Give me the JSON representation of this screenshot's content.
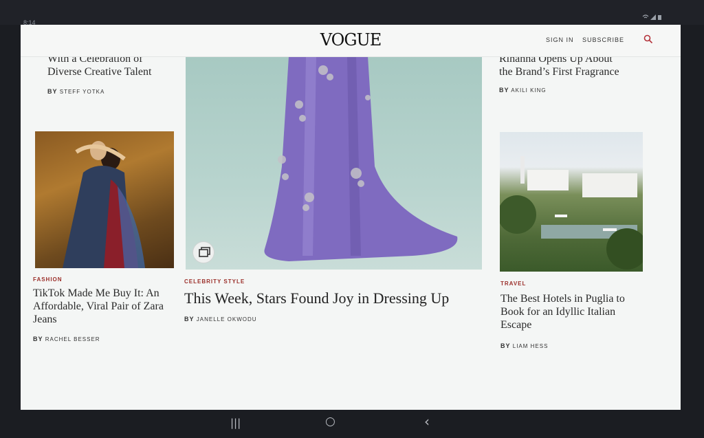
{
  "status": {
    "time": "8:14",
    "icons": "wifi-signal-battery-icons"
  },
  "header": {
    "logo": "VOGUE",
    "sign_in": "SIGN IN",
    "subscribe": "SUBSCRIBE",
    "search_icon": "search-icon"
  },
  "articles": {
    "top_left": {
      "headline_line1": "With a Celebration of",
      "headline_line2": "Diverse Creative Talent",
      "by": "BY",
      "author": "STEFF YOTKA"
    },
    "top_right": {
      "headline_line1": "Rihanna Opens Up About",
      "headline_line2": "the Brand’s First Fragrance",
      "by": "BY",
      "author": "AKILI KING"
    },
    "left": {
      "kicker": "FASHION",
      "headline": "TikTok Made Me Buy It: An Affordable, Viral Pair of Zara Jeans",
      "by": "BY",
      "author": "RACHEL BESSER"
    },
    "center": {
      "kicker": "CELEBRITY STYLE",
      "headline": "This Week, Stars Found Joy in Dressing Up",
      "by": "BY",
      "author": "JANELLE OKWODU"
    },
    "right": {
      "kicker": "TRAVEL",
      "headline": "The Best Hotels in Puglia to Book for an Idyllic Italian Escape",
      "by": "BY",
      "author": "LIAM HESS"
    }
  },
  "nav": {
    "recents": "|||",
    "home": "○",
    "back": "‹"
  },
  "colors": {
    "accent_kicker": "#9b2f2a",
    "gown": "#7f6bc0",
    "background": "#f4f6f5"
  }
}
